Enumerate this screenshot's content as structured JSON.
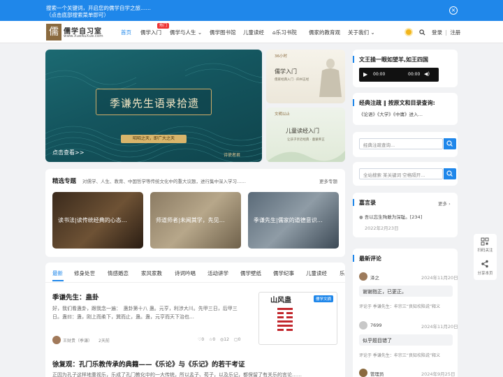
{
  "topbar": {
    "line1": "搜索一个关键词，开启您的儒学自学之旅……",
    "line2": "（点击底部搜索菜单即可）",
    "close": "×"
  },
  "logo": {
    "seal": "儒",
    "name": "儒学自习室",
    "url": "www.XueRuXue.com"
  },
  "nav": {
    "items": [
      "首页",
      "儒学入门",
      "儒学与人生",
      "儒学图书馆",
      "儿童读经",
      "乐习书院",
      "儒家的教育观",
      "关于我们"
    ],
    "hot_badge": "热门",
    "login": "登录",
    "sep": "|",
    "register": "注册"
  },
  "hero": {
    "banner": "季谦先生语录拾遗",
    "slogan": "昭昭之天，即广大之天",
    "caption": "点击查看>>",
    "sign": "诗使者君"
  },
  "cards": [
    {
      "tag": "36小时",
      "title": "儒学入门",
      "sub": "儒家经典入门 · 四书五经"
    },
    {
      "tag": "文明以止",
      "title": "儿童读经入门",
      "sub": "让孩子亲近经典 · 童蒙养正"
    }
  ],
  "topics": {
    "heading": "精选专题",
    "desc": "对儒学、人生、教育、中国哲学等传统文化中的重大议题，进行集中深入学习……",
    "more": "更多专题",
    "items": [
      "读书法|读传统经典的心态…",
      "师道师者|未闻其学，先见…",
      "季谦先生|儒家的道德意识…"
    ]
  },
  "tabs": [
    "最新",
    "修身处世",
    "情感婚恋",
    "家风家教",
    "诗词吟唱",
    "活动讲学",
    "儒学壁纸",
    "儒学纪事",
    "儿童读经",
    "乐"
  ],
  "articles": [
    {
      "title": "季谦先生：蛊卦",
      "body": "好，我们看蛊卦，跟我念一遍：　蛊卦第十八 蛊。元亨，利涉大川。先甲三日，后甲三日。蛊曰：蛊，刚上而柔下，巽而止，蛊。蛊，元亨而天下治也…",
      "author": "王财贵（季谦）",
      "time": "2天前",
      "likes": "0",
      "favs": "0",
      "views": "12",
      "comments": "0",
      "thumb_title": "山风蛊",
      "thumb_tag": "儒学文摘"
    },
    {
      "title": "徐复观：孔门乐教传承的典籍——《乐论》与《乐记》的若干考证",
      "body": "正因为孔子这样地重视乐，乐成了孔门教化中的一大传统，所以孟子、荀子，以及乐记，都保留了有关乐的言论……"
    }
  ],
  "sidebar": {
    "audio": {
      "title": "文王操一眼如望羊,如王四国",
      "time1": "00:00",
      "time2": "00:00"
    },
    "classic": {
      "title": "经典注疏 ‖ 按原文和目录查询:",
      "links": "《论语》《大学》《中庸》进入…"
    },
    "search1": {
      "placeholder": "经典注疏查询..."
    },
    "search2": {
      "placeholder": "全站搜索 某关键词 空格隔开..."
    },
    "quotes": {
      "title": "嘉言录",
      "more": "更多",
      "item": "吾以忘生殉敢为深耻。[234]",
      "date": "2022年2月23日"
    },
    "comments": {
      "title": "最新评论",
      "list": [
        {
          "name": "泽之",
          "date": "2024年11月20日",
          "text": "谢谢指正，已更正。",
          "ref": "评论于 季谦先生：牟宗三“良知坎陷说”释义"
        },
        {
          "name": "7699",
          "date": "2024年11月20日",
          "text": "似乎题目错了",
          "ref": "评论于 季谦先生：牟宗三“良知坎陷说”释义"
        },
        {
          "name": "管理员",
          "date": "2024年9月25日",
          "text": "",
          "ref": ""
        }
      ]
    }
  },
  "float": {
    "qr": "扫码关注",
    "share": "分享本页"
  }
}
